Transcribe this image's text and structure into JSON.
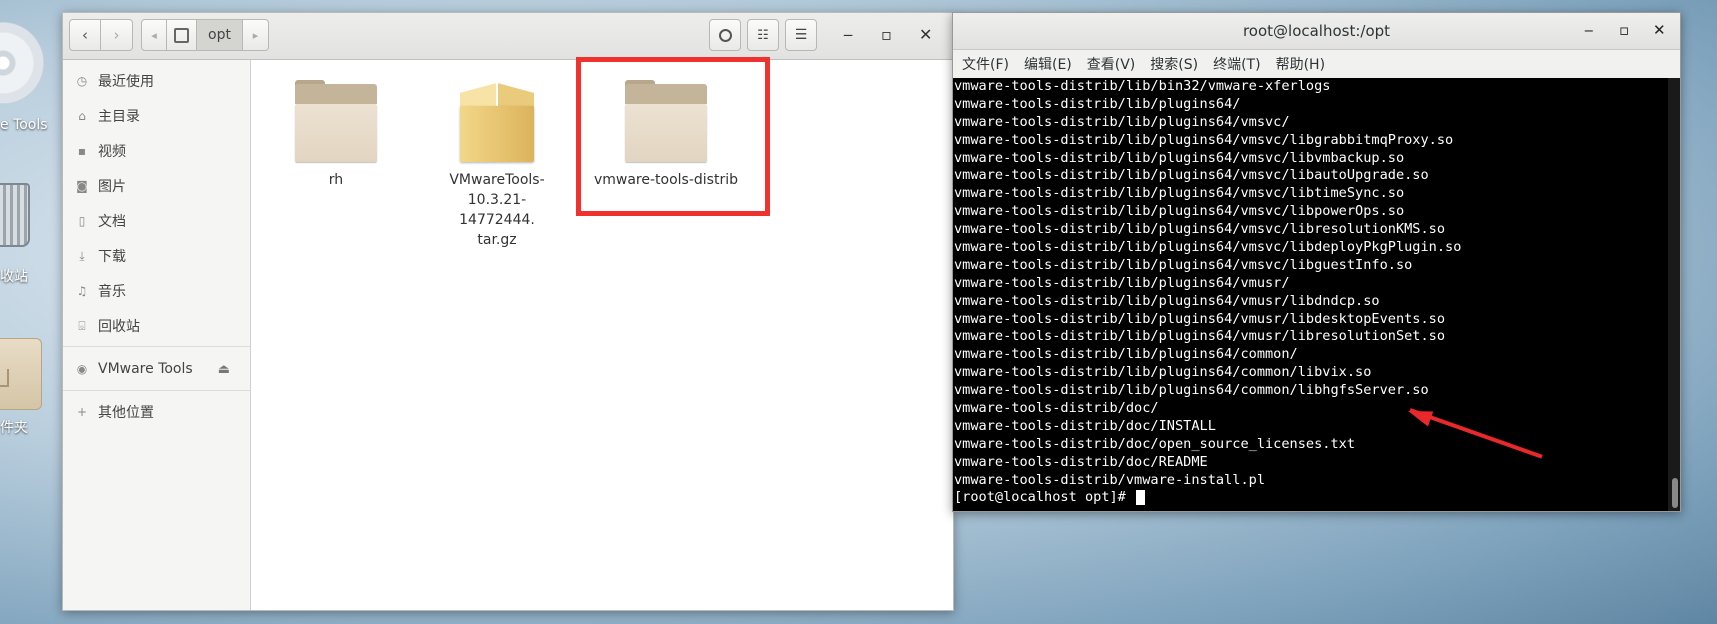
{
  "desktop": {
    "icons": [
      {
        "label": "e Tools"
      },
      {
        "label": "收站"
      },
      {
        "label": "件夹"
      }
    ]
  },
  "file_manager": {
    "path_segment": "opt",
    "sidebar": [
      {
        "label": "最近使用",
        "icon": "clock-icon"
      },
      {
        "label": "主目录",
        "icon": "home-icon"
      },
      {
        "label": "视频",
        "icon": "video-icon"
      },
      {
        "label": "图片",
        "icon": "camera-icon"
      },
      {
        "label": "文档",
        "icon": "document-icon"
      },
      {
        "label": "下载",
        "icon": "download-icon"
      },
      {
        "label": "音乐",
        "icon": "music-icon"
      },
      {
        "label": "回收站",
        "icon": "trash-icon"
      },
      {
        "label": "VMware Tools",
        "icon": "disc-icon"
      },
      {
        "label": "其他位置",
        "icon": "plus-icon"
      }
    ],
    "files": [
      {
        "name": "rh",
        "type": "folder"
      },
      {
        "name": "VMwareTools-10.3.21-14772444.tar.gz",
        "name_lines": [
          "VMwareTools-",
          "10.3.21-14772444.",
          "tar.gz"
        ],
        "type": "archive"
      },
      {
        "name": "vmware-tools-distrib",
        "type": "folder",
        "highlighted": true
      }
    ],
    "colors": {
      "highlight": "#f0322f"
    }
  },
  "terminal": {
    "title": "root@localhost:/opt",
    "menu": [
      "文件(F)",
      "编辑(E)",
      "查看(V)",
      "搜索(S)",
      "终端(T)",
      "帮助(H)"
    ],
    "lines": [
      "vmware-tools-distrib/lib/bin32/vmware-xferlogs",
      "vmware-tools-distrib/lib/plugins64/",
      "vmware-tools-distrib/lib/plugins64/vmsvc/",
      "vmware-tools-distrib/lib/plugins64/vmsvc/libgrabbitmqProxy.so",
      "vmware-tools-distrib/lib/plugins64/vmsvc/libvmbackup.so",
      "vmware-tools-distrib/lib/plugins64/vmsvc/libautoUpgrade.so",
      "vmware-tools-distrib/lib/plugins64/vmsvc/libtimeSync.so",
      "vmware-tools-distrib/lib/plugins64/vmsvc/libpowerOps.so",
      "vmware-tools-distrib/lib/plugins64/vmsvc/libresolutionKMS.so",
      "vmware-tools-distrib/lib/plugins64/vmsvc/libdeployPkgPlugin.so",
      "vmware-tools-distrib/lib/plugins64/vmsvc/libguestInfo.so",
      "vmware-tools-distrib/lib/plugins64/vmusr/",
      "vmware-tools-distrib/lib/plugins64/vmusr/libdndcp.so",
      "vmware-tools-distrib/lib/plugins64/vmusr/libdesktopEvents.so",
      "vmware-tools-distrib/lib/plugins64/vmusr/libresolutionSet.so",
      "vmware-tools-distrib/lib/plugins64/common/",
      "vmware-tools-distrib/lib/plugins64/common/libvix.so",
      "vmware-tools-distrib/lib/plugins64/common/libhgfsServer.so",
      "vmware-tools-distrib/doc/",
      "vmware-tools-distrib/doc/INSTALL",
      "vmware-tools-distrib/doc/open_source_licenses.txt",
      "vmware-tools-distrib/doc/README",
      "vmware-tools-distrib/vmware-install.pl"
    ],
    "prompt": "[root@localhost opt]# ",
    "colors": {
      "arrow": "#e8282a"
    }
  }
}
